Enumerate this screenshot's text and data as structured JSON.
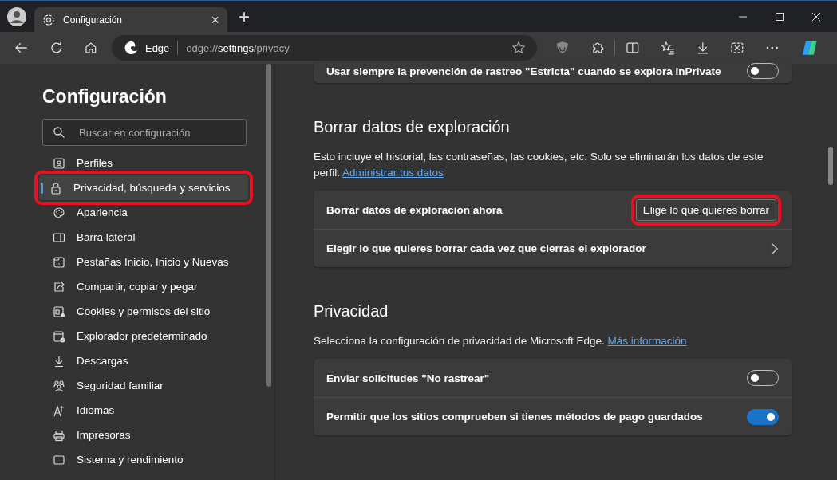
{
  "tab": {
    "title": "Configuración",
    "close": "×"
  },
  "new_tab": "+",
  "address_bar": {
    "site": "Edge",
    "url": "edge://**settings**/privacy"
  },
  "sidebar": {
    "title": "Configuración",
    "search": {
      "placeholder": "Buscar en configuración"
    },
    "items": [
      {
        "label": "Perfiles",
        "selected": false,
        "highlighted": false
      },
      {
        "label": "Privacidad, búsqueda y servicios",
        "selected": true,
        "highlighted": true
      },
      {
        "label": "Apariencia",
        "selected": false,
        "highlighted": false
      },
      {
        "label": "Barra lateral",
        "selected": false,
        "highlighted": false
      },
      {
        "label": "Pestañas Inicio, Inicio y Nuevas",
        "selected": false,
        "highlighted": false
      },
      {
        "label": "Compartir, copiar y pegar",
        "selected": false,
        "highlighted": false
      },
      {
        "label": "Cookies y permisos del sitio",
        "selected": false,
        "highlighted": false
      },
      {
        "label": "Explorador predeterminado",
        "selected": false,
        "highlighted": false
      },
      {
        "label": "Descargas",
        "selected": false,
        "highlighted": false
      },
      {
        "label": "Seguridad familiar",
        "selected": false,
        "highlighted": false
      },
      {
        "label": "Idiomas",
        "selected": false,
        "highlighted": false
      },
      {
        "label": "Impresoras",
        "selected": false,
        "highlighted": false
      },
      {
        "label": "Sistema y rendimiento",
        "selected": false,
        "highlighted": false
      }
    ]
  },
  "sections": [
    {
      "cards": [
        {
          "kind": "toggle",
          "label": "Usar siempre la prevención de rastreo \"Estricta\" cuando se explora InPrivate",
          "on": false
        }
      ]
    },
    {
      "heading": "Borrar datos de exploración",
      "description": "Esto incluye el historial, las contraseñas, las cookies, etc. Solo se eliminarán los datos de este perfil.",
      "link": "Administrar tus datos",
      "cards": [
        {
          "kind": "button",
          "label": "Borrar datos de exploración ahora",
          "button": "Elige lo que quieres borrar",
          "highlighted": true
        },
        {
          "kind": "chevron",
          "label": "Elegir lo que quieres borrar cada vez que cierras el explorador"
        }
      ]
    },
    {
      "heading": "Privacidad",
      "description": "Selecciona la configuración de privacidad de Microsoft Edge.",
      "link": "Más información",
      "cards": [
        {
          "kind": "toggle",
          "label": "Enviar solicitudes \"No rastrear\"",
          "on": false
        },
        {
          "kind": "toggle",
          "label": "Permitir que los sitios comprueben si tienes métodos de pago guardados",
          "on": true
        }
      ]
    }
  ]
}
